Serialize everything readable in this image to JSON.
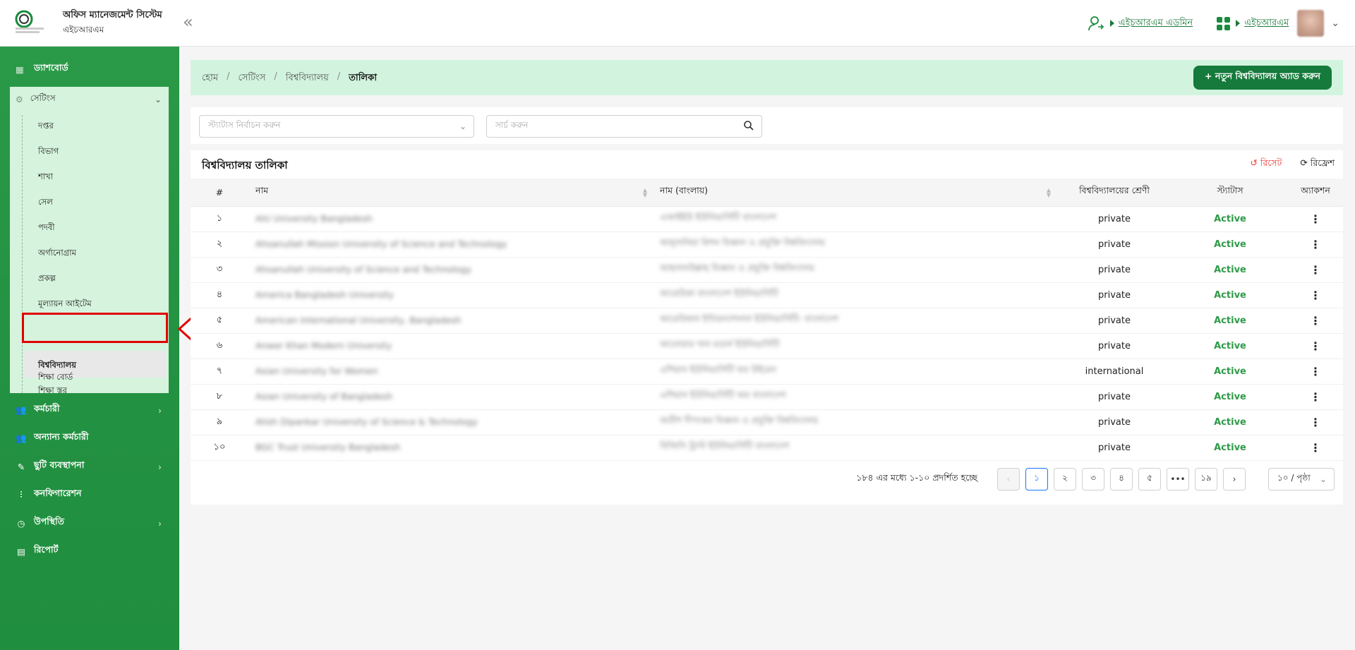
{
  "header": {
    "app_title": "অফিস ম্যানেজমেন্ট সিস্টেম",
    "app_subtitle": "এইচআরএম",
    "collapse_symbol": "«",
    "user_role_link": "এইচআরএম এডমিন",
    "module_link": "এইচআরএম"
  },
  "sidebar": {
    "dashboard": "ড্যাশবোর্ড",
    "settings": "সেটিংস",
    "settings_items": [
      "দপ্তর",
      "বিভাগ",
      "শাখা",
      "সেল",
      "পদবী",
      "অর্গানোগ্রাম",
      "প্রকল্প",
      "মূল্যায়ন আইটেম",
      "বিশ্ববিদ্যালয়",
      "শিক্ষা স্তর",
      "শিক্ষা বোর্ড"
    ],
    "employee": "কর্মচারী",
    "other_employee": "অন্যান্য কর্মচারী",
    "leave_management": "ছুটি ব্যবস্থাপনা",
    "configuration": "কনফিগারেশন",
    "attendance": "উপস্থিতি",
    "report": "রিপোর্ট"
  },
  "breadcrumb": {
    "home": "হোম",
    "settings": "সেটিংস",
    "university": "বিশ্ববিদ্যালয়",
    "current": "তালিকা"
  },
  "add_button": "+ নতুন বিশ্ববিদ্যালয় অ্যাড করুন",
  "filters": {
    "status_placeholder": "স্ট্যাটাস নির্বাচন করুন",
    "search_placeholder": "সার্চ করুন"
  },
  "table": {
    "title": "বিশ্ববিদ্যালয় তালিকা",
    "reset": "রিসেট",
    "refresh": "রিফ্রেশ",
    "headers": {
      "num": "#",
      "name": "নাম",
      "name_bn": "নাম (বাংলায়)",
      "category": "বিশ্ববিদ্যালয়ের শ্রেণী",
      "status": "স্ট্যাটাস",
      "action": "অ্যাকশন"
    },
    "rows": [
      {
        "num": "১",
        "name": "AIU University Bangladesh",
        "name_bn": "এআইইউ ইউনিভার্সিটি বাংলাদেশ",
        "category": "private",
        "status": "Active"
      },
      {
        "num": "২",
        "name": "Ahsanullah Mission University of Science and Technology",
        "name_bn": "আহ্সানিয়া মিশন বিজ্ঞান ও প্রযুক্তি বিশ্ববিদ্যালয়",
        "category": "private",
        "status": "Active"
      },
      {
        "num": "৩",
        "name": "Ahsanullah University of Science and Technology",
        "name_bn": "আহসানউল্লাহ বিজ্ঞান ও প্রযুক্তি বিশ্ববিদ্যালয়",
        "category": "private",
        "status": "Active"
      },
      {
        "num": "৪",
        "name": "America Bangladesh University",
        "name_bn": "আমেরিকা বাংলাদেশ ইউনিভার্সিটি",
        "category": "private",
        "status": "Active"
      },
      {
        "num": "৫",
        "name": "American International University, Bangladesh",
        "name_bn": "আমেরিকান ইন্টারন্যাশনাল ইউনিভার্সিটি- বাংলাদেশ",
        "category": "private",
        "status": "Active"
      },
      {
        "num": "৬",
        "name": "Anwer Khan Modern University",
        "name_bn": "আনোয়ার খান মডার্ন ইউনিভার্সিটি",
        "category": "private",
        "status": "Active"
      },
      {
        "num": "৭",
        "name": "Asian University for Women",
        "name_bn": "এশিয়ান ইউনিভার্সিটি ফর উইমেন",
        "category": "international",
        "status": "Active"
      },
      {
        "num": "৮",
        "name": "Asian University of Bangladesh",
        "name_bn": "এশিয়ান ইউনিভার্সিটি অব বাংলাদেশ",
        "category": "private",
        "status": "Active"
      },
      {
        "num": "৯",
        "name": "Atish Dipankar University of Science & Technology",
        "name_bn": "অতীশ দীপংকর বিজ্ঞান ও প্রযুক্তি বিশ্ববিদ্যালয়",
        "category": "private",
        "status": "Active"
      },
      {
        "num": "১০",
        "name": "BGC Trust University Bangladesh",
        "name_bn": "বিজিসি ট্রাস্ট ইউনিভার্সিটি বাংলাদেশ",
        "category": "private",
        "status": "Active"
      }
    ]
  },
  "pagination": {
    "info": "১৮৪ এর মধ্যে ১-১০ প্রদর্শিত হচ্ছে",
    "pages": [
      "১",
      "২",
      "৩",
      "৪",
      "৫",
      "•••",
      "১৯"
    ],
    "page_size": "১০ / পৃষ্ঠা"
  },
  "colors": {
    "primary_green": "#157a3b",
    "sidebar_green": "#239242",
    "status_active": "#2e9a48",
    "reset_red": "#e53935",
    "highlight_red": "#e00000"
  }
}
